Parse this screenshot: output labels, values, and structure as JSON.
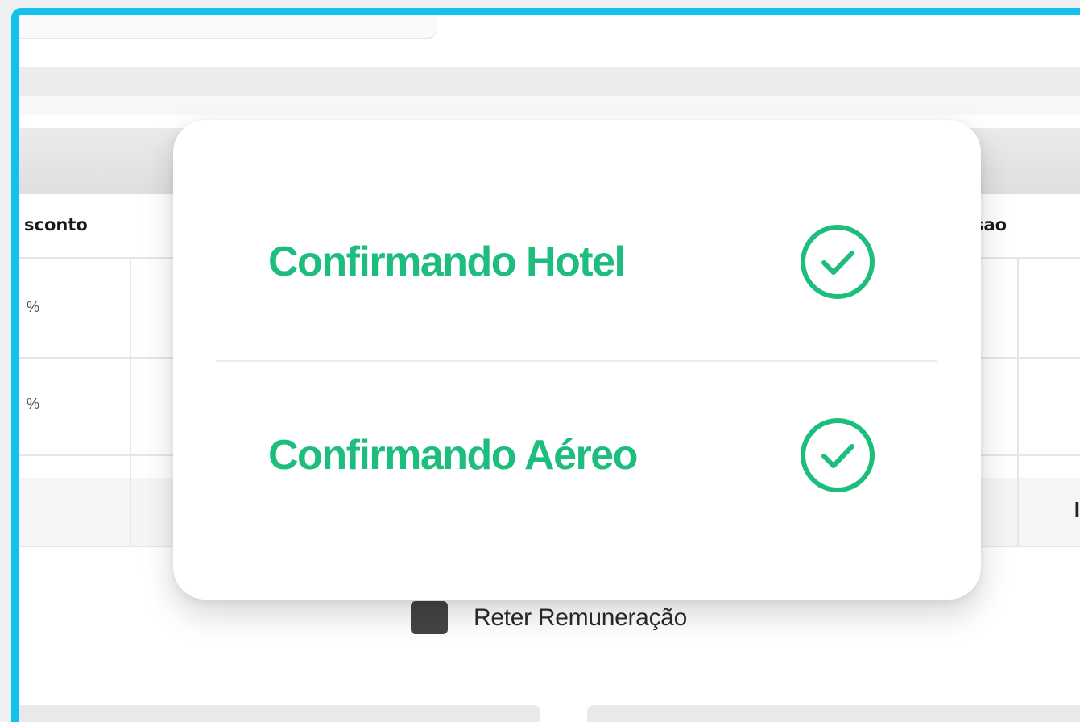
{
  "theme": {
    "accent": "#1dbd7d",
    "frame_border": "#12c1ec"
  },
  "background_table": {
    "columns": {
      "left_header": "sconto",
      "right_header": "sao"
    },
    "rows": [
      {
        "value": "%"
      },
      {
        "value": "%"
      }
    ]
  },
  "retain_option": {
    "label": "Reter Remuneração",
    "checked": true
  },
  "modal": {
    "items": [
      {
        "label": "Confirmando Hotel",
        "status": "confirmed",
        "icon": "check-circle-icon"
      },
      {
        "label": "Confirmando Aéreo",
        "status": "confirmed",
        "icon": "check-circle-icon"
      }
    ]
  }
}
